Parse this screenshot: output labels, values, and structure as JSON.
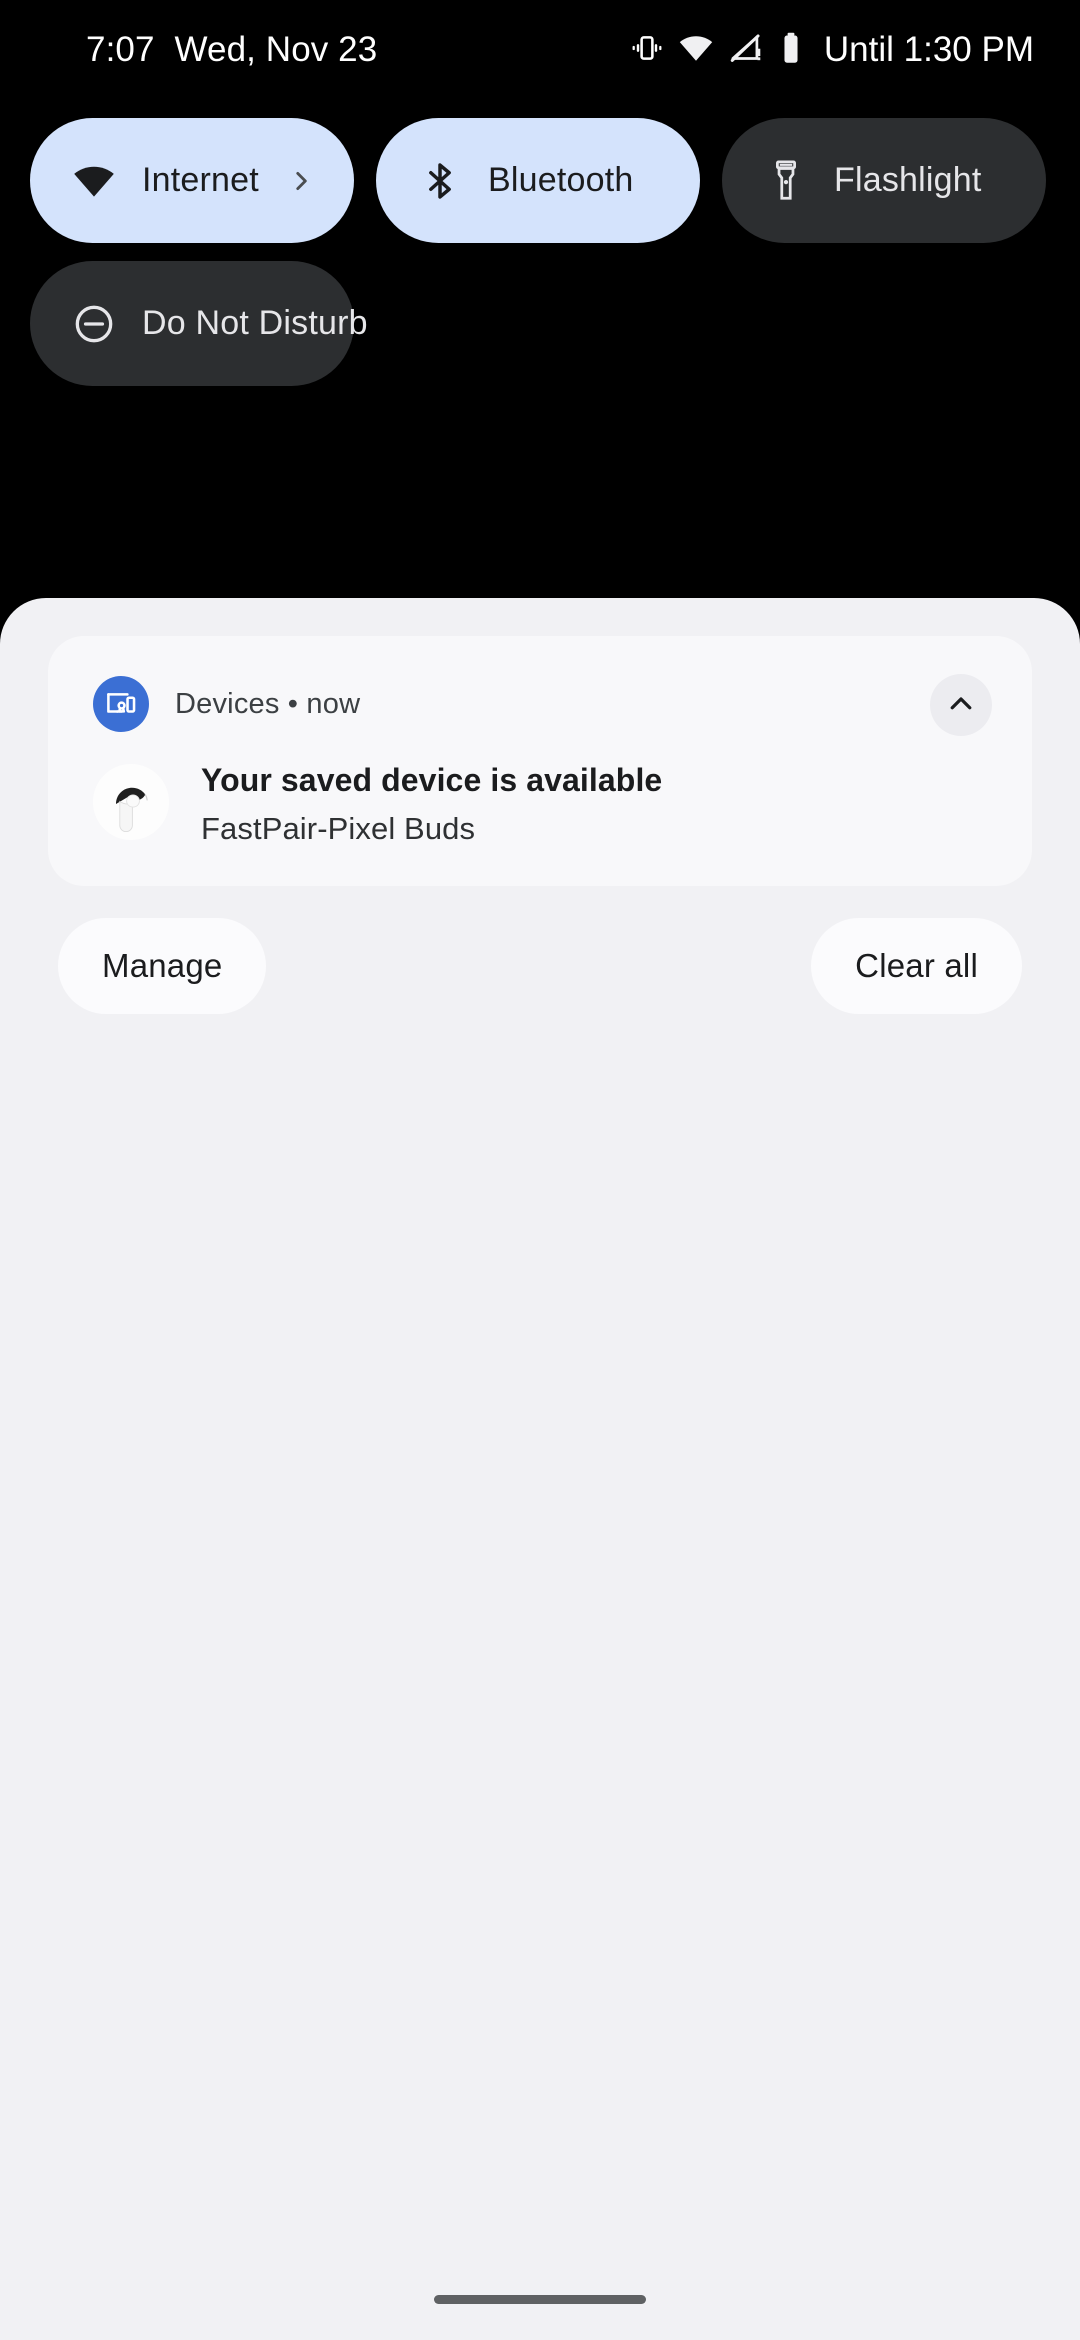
{
  "status_bar": {
    "clock": "7:07",
    "date": "Wed, Nov 23",
    "icons": [
      "vibrate-icon",
      "wifi-icon",
      "no-sim-signal-icon",
      "battery-icon"
    ],
    "dnd_until": "Until 1:30 PM"
  },
  "quick_settings": {
    "tiles": [
      {
        "label": "Internet",
        "icon": "wifi-icon",
        "state": "active",
        "has_chevron": true
      },
      {
        "label": "Bluetooth",
        "icon": "bluetooth-icon",
        "state": "active",
        "has_chevron": false
      },
      {
        "label": "Flashlight",
        "icon": "flashlight-icon",
        "state": "inactive",
        "has_chevron": false
      },
      {
        "label": "Do Not Disturb",
        "icon": "do-not-disturb-icon",
        "state": "inactive",
        "has_chevron": false
      }
    ]
  },
  "notification": {
    "app_icon": "devices-icon",
    "source": "Devices",
    "separator": "•",
    "time": "now",
    "source_line": "Devices • now",
    "collapse_icon": "chevron-up-icon",
    "thumbnail": "pixel-buds-image",
    "title": "Your saved device is available",
    "subtitle": "FastPair-Pixel Buds"
  },
  "shade_actions": {
    "manage_label": "Manage",
    "clear_all_label": "Clear all"
  },
  "colors": {
    "background": "#000000",
    "tile_active_bg": "#d4e3fc",
    "tile_inactive_bg": "#2c2e30",
    "shade_bg": "#f1f1f4",
    "card_bg": "#f8f8fa",
    "app_badge_blue": "#3b6fd4",
    "text_primary": "#1b1c1e"
  }
}
